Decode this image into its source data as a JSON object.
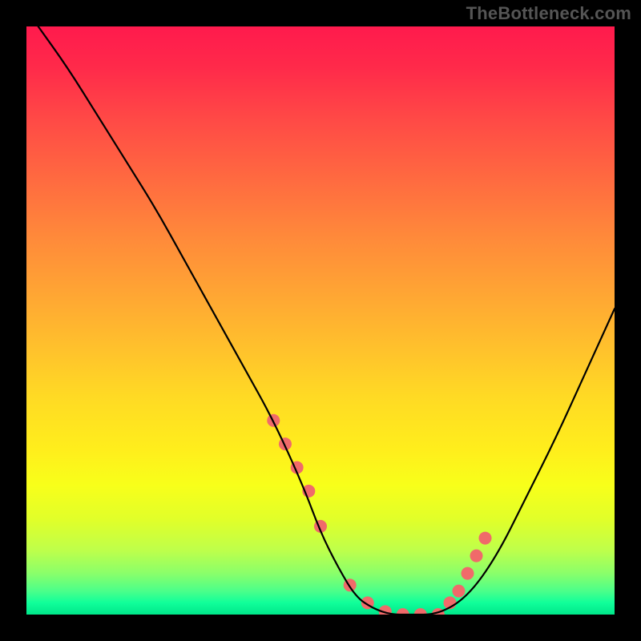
{
  "watermark": "TheBottleneck.com",
  "chart_data": {
    "type": "line",
    "title": "",
    "xlabel": "",
    "ylabel": "",
    "xlim": [
      0,
      100
    ],
    "ylim": [
      0,
      100
    ],
    "series": [
      {
        "name": "curve",
        "x": [
          2,
          7,
          12,
          17,
          22,
          27,
          32,
          37,
          42,
          47,
          50,
          53,
          56,
          59,
          62,
          65,
          70,
          75,
          80,
          85,
          90,
          95,
          100
        ],
        "values": [
          100,
          93,
          85,
          77,
          69,
          60,
          51,
          42,
          33,
          22,
          14,
          8,
          3,
          1,
          0,
          0,
          0,
          3,
          10,
          20,
          30,
          41,
          52
        ]
      }
    ],
    "markers": {
      "name": "highlight-dots",
      "x": [
        42,
        44,
        46,
        48,
        50,
        55,
        58,
        61,
        64,
        67,
        70,
        72,
        73.5,
        75,
        76.5,
        78
      ],
      "values": [
        33,
        29,
        25,
        21,
        15,
        5,
        2,
        0.5,
        0,
        0,
        0,
        2,
        4,
        7,
        10,
        13
      ],
      "color": "#f06a6a",
      "radius": 8
    },
    "gradient_stops": [
      {
        "pos": 0,
        "color": "#ff1a4d"
      },
      {
        "pos": 36,
        "color": "#ff8a3a"
      },
      {
        "pos": 72,
        "color": "#ffee1c"
      },
      {
        "pos": 100,
        "color": "#00e78a"
      }
    ]
  }
}
